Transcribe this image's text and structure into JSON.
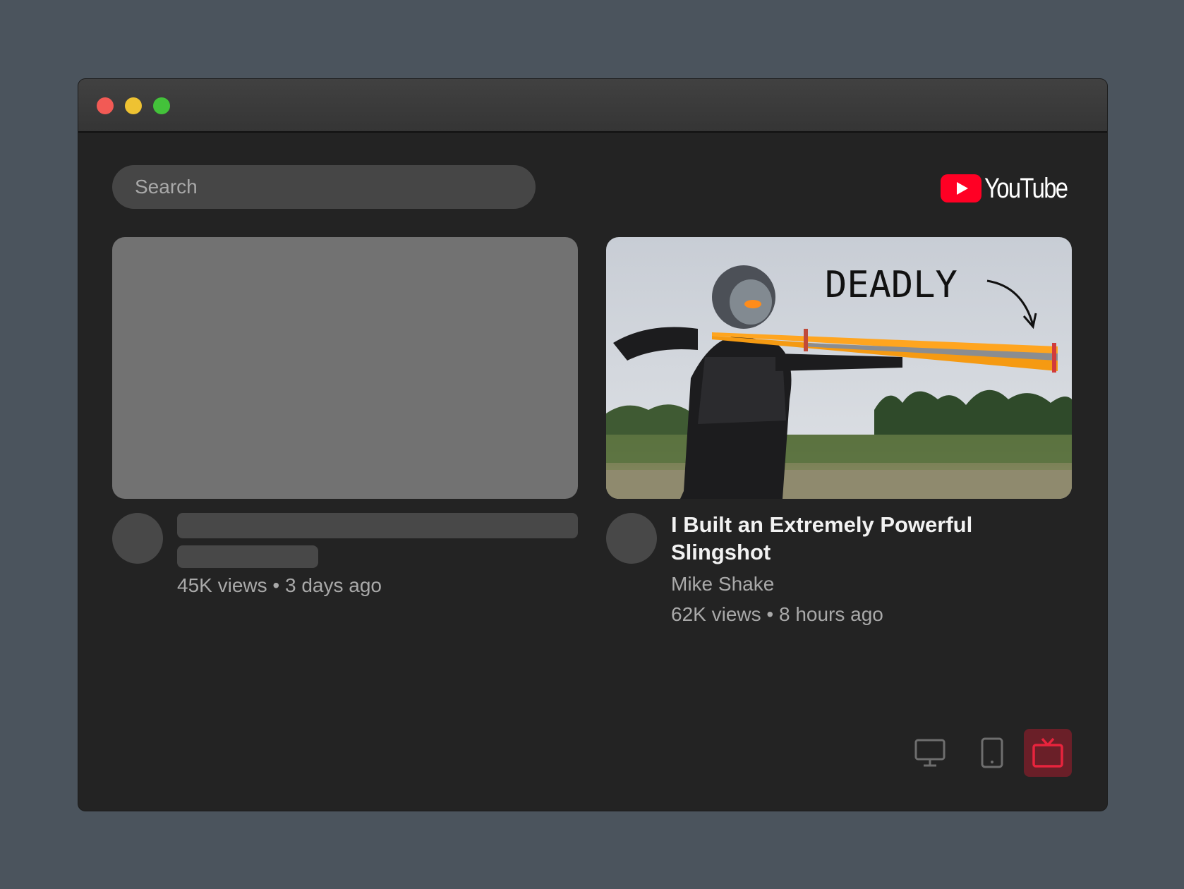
{
  "search": {
    "placeholder": "Search"
  },
  "logo": {
    "text": "YouTube",
    "color": "#ff0024"
  },
  "videos": [
    {
      "state": "loading",
      "meta": "45K views • 3 days ago"
    },
    {
      "state": "loaded",
      "title": "I Built an Extremely Powerful Slingshot",
      "channel": "Mike Shake",
      "meta": "62K views • 8 hours ago",
      "thumbnail_text": "DEADLY"
    }
  ],
  "device_toggle": {
    "options": [
      "desktop-icon",
      "tablet-icon",
      "tv-icon"
    ],
    "selected": "tv-icon",
    "accent": "#e8243d"
  },
  "window_controls": [
    "close",
    "minimize",
    "maximize"
  ]
}
